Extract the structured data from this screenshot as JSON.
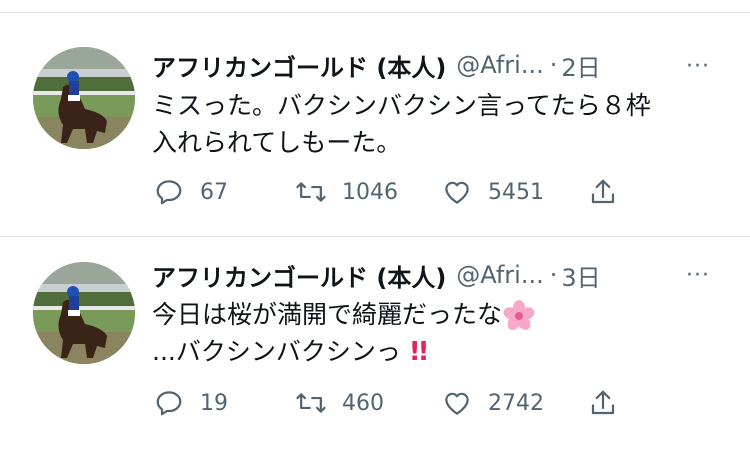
{
  "tweets": [
    {
      "display_name": "アフリカンゴールド (本人)",
      "handle": "@Afri...",
      "dot": "·",
      "time": "2日",
      "more": "···",
      "text_line1": "ミスった。バクシンバクシン言ってたら８枠",
      "text_line2": "入れられてしもーた。",
      "replies": "67",
      "retweets": "1046",
      "likes": "5451"
    },
    {
      "display_name": "アフリカンゴールド (本人)",
      "handle": "@Afri...",
      "dot": "·",
      "time": "3日",
      "more": "···",
      "text_line1": "今日は桜が満開で綺麗だったな",
      "text_line2": "...バクシンバクシンっ",
      "text_emoji_1": "🌸",
      "text_emoji_2": "‼️",
      "replies": "19",
      "retweets": "460",
      "likes": "2742"
    }
  ],
  "icons": {
    "reply": "reply-icon",
    "retweet": "retweet-icon",
    "like": "heart-icon",
    "share": "share-icon",
    "more": "more-icon"
  },
  "colors": {
    "text": "#0f1419",
    "secondary": "#536471",
    "divider": "#e1e5e8",
    "accent_red": "#e0245e"
  }
}
